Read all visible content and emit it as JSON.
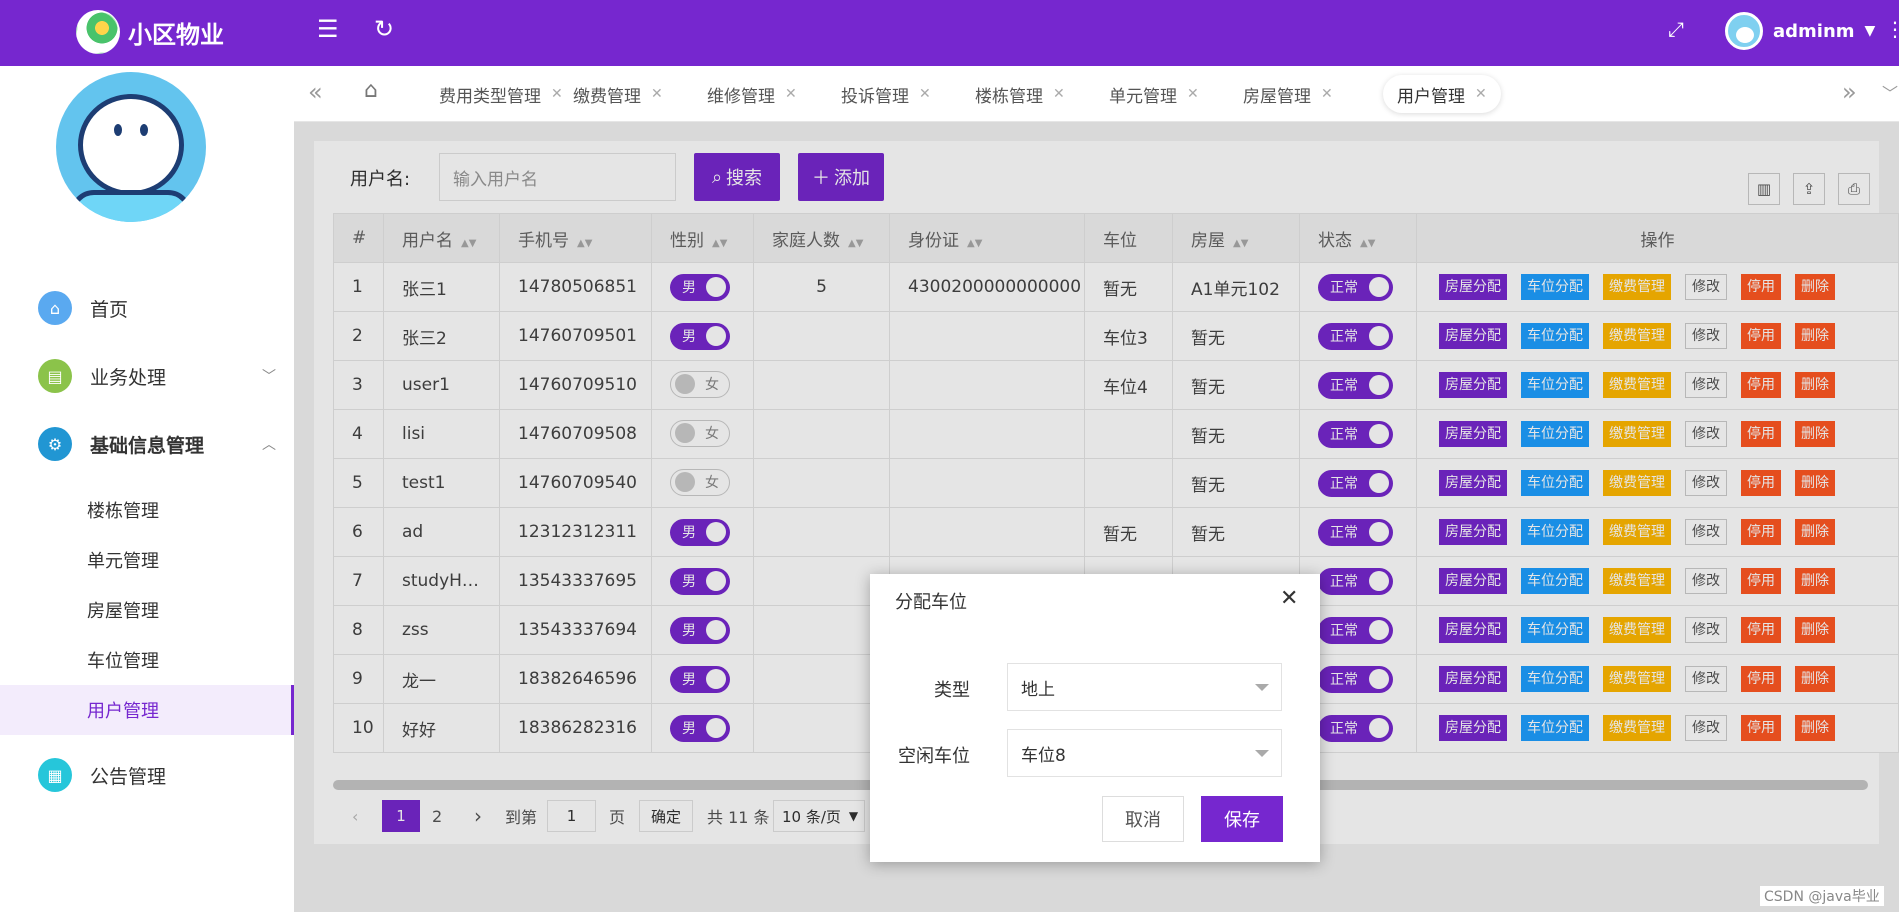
{
  "app": {
    "title": "小区物业",
    "user": "adminm"
  },
  "tabs": [
    "费用类型管理",
    "缴费管理",
    "维修管理",
    "投诉管理",
    "楼栋管理",
    "单元管理",
    "房屋管理",
    "用户管理"
  ],
  "sidebar": {
    "home": "首页",
    "business": "业务处理",
    "basic": "基础信息管理",
    "subs": [
      "楼栋管理",
      "单元管理",
      "房屋管理",
      "车位管理",
      "用户管理"
    ],
    "notice": "公告管理"
  },
  "search": {
    "label": "用户名:",
    "placeholder": "输入用户名",
    "search_btn": "搜索",
    "add_btn": "添加"
  },
  "table": {
    "headers": [
      "#",
      "用户名",
      "手机号",
      "性别",
      "家庭人数",
      "身份证",
      "车位",
      "房屋",
      "状态",
      "操作"
    ],
    "rows": [
      {
        "no": "1",
        "name": "张三1",
        "phone": "14780506851",
        "gender": "男",
        "family": "5",
        "id": "4300200000000000",
        "parking": "暂无",
        "house": "A1单元102",
        "status": "正常"
      },
      {
        "no": "2",
        "name": "张三2",
        "phone": "14760709501",
        "gender": "男",
        "family": "",
        "id": "",
        "parking": "车位3",
        "house": "暂无",
        "status": "正常"
      },
      {
        "no": "3",
        "name": "user1",
        "phone": "14760709510",
        "gender": "女",
        "family": "",
        "id": "",
        "parking": "车位4",
        "house": "暂无",
        "status": "正常"
      },
      {
        "no": "4",
        "name": "lisi",
        "phone": "14760709508",
        "gender": "女",
        "family": "",
        "id": "",
        "parking": "",
        "house": "暂无",
        "status": "正常"
      },
      {
        "no": "5",
        "name": "test1",
        "phone": "14760709540",
        "gender": "女",
        "family": "",
        "id": "",
        "parking": "",
        "house": "暂无",
        "status": "正常"
      },
      {
        "no": "6",
        "name": "ad",
        "phone": "12312312311",
        "gender": "男",
        "family": "",
        "id": "",
        "parking": "暂无",
        "house": "暂无",
        "status": "正常"
      },
      {
        "no": "7",
        "name": "studyH…",
        "phone": "13543337695",
        "gender": "男",
        "family": "",
        "id": "",
        "parking": "",
        "house": "",
        "status": "正常"
      },
      {
        "no": "8",
        "name": "zss",
        "phone": "13543337694",
        "gender": "男",
        "family": "",
        "id": "",
        "parking": "",
        "house": "",
        "status": "正常"
      },
      {
        "no": "9",
        "name": "龙一",
        "phone": "18382646596",
        "gender": "男",
        "family": "",
        "id": "",
        "parking": "",
        "house": "",
        "status": "正常"
      },
      {
        "no": "10",
        "name": "好好",
        "phone": "18386282316",
        "gender": "男",
        "family": "",
        "id": "",
        "parking": "",
        "house": "",
        "status": "正常"
      }
    ],
    "actions": [
      "房屋分配",
      "车位分配",
      "缴费管理",
      "修改",
      "停用",
      "删除"
    ]
  },
  "pager": {
    "pages": [
      "1",
      "2"
    ],
    "goto": "到第",
    "page_input": "1",
    "page_unit": "页",
    "confirm": "确定",
    "total": "共 11 条",
    "per_page": "10 条/页"
  },
  "dialog": {
    "title": "分配车位",
    "type_label": "类型",
    "type_value": "地上",
    "space_label": "空闲车位",
    "space_value": "车位8",
    "cancel": "取消",
    "save": "保存"
  },
  "footer": "CSDN @java毕业",
  "colors": {
    "primary": "#7627cf",
    "blue": "#1e9fff",
    "yellow": "#ffb800",
    "red": "#ff5722"
  }
}
